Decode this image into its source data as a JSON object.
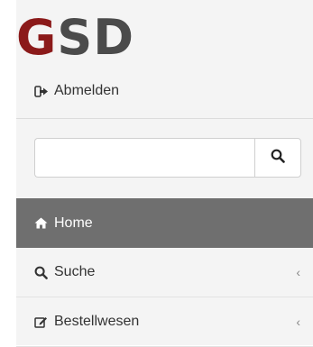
{
  "brand": {
    "logo_g": "G",
    "logo_rest": "SD",
    "g_color": "#8b1a1a",
    "rest_color": "#4b4b4b"
  },
  "user": {
    "logout_label": "Abmelden"
  },
  "search": {
    "value": "",
    "placeholder": ""
  },
  "menu": {
    "items": [
      {
        "label": "Home",
        "icon": "home-icon",
        "active": true,
        "expandable": false
      },
      {
        "label": "Suche",
        "icon": "search-icon",
        "active": false,
        "expandable": true
      },
      {
        "label": "Bestellwesen",
        "icon": "edit-icon",
        "active": false,
        "expandable": true
      }
    ],
    "chevron": "‹",
    "active_bg": "#6f6f6f"
  }
}
